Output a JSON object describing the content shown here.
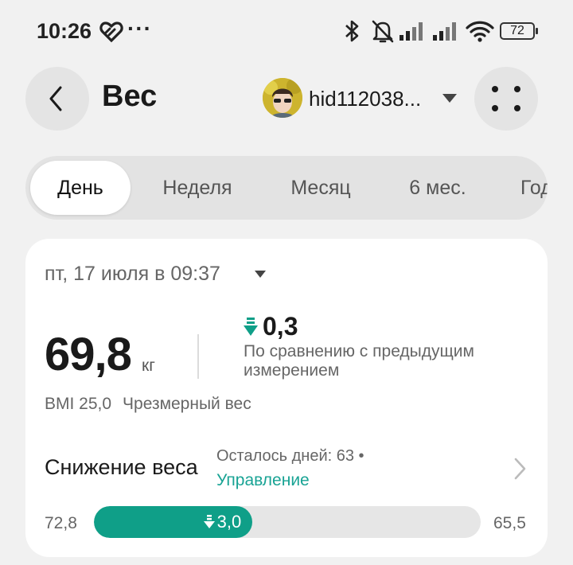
{
  "status_bar": {
    "time": "10:26",
    "dots": "···",
    "battery": "72",
    "icons": [
      "heart-icon",
      "bluetooth-icon",
      "mute-icon",
      "signal-icon",
      "signal-icon",
      "wifi-icon",
      "battery-icon"
    ]
  },
  "header": {
    "title": "Вес",
    "account_name": "hid112038...",
    "back_icon": "chevron-left-icon",
    "more_icon": "grid-dots-icon"
  },
  "tabs": [
    {
      "label": "День",
      "active": true
    },
    {
      "label": "Неделя",
      "active": false
    },
    {
      "label": "Месяц",
      "active": false
    },
    {
      "label": "6 мес.",
      "active": false
    },
    {
      "label": "Год",
      "active": false
    }
  ],
  "summary": {
    "date": "пт, 17 июля в 09:37",
    "weight": "69,8",
    "unit": "кг",
    "delta": "0,3",
    "delta_direction": "down",
    "delta_caption": "По сравнению с предыдущим измерением",
    "bmi": "BMI 25,0",
    "bmi_status": "Чрезмерный вес"
  },
  "goal": {
    "title": "Снижение веса",
    "days_left": "Осталось дней: 63 •",
    "manage_label": "Управление",
    "start": "72,8",
    "end": "65,5",
    "progress_label": "3,0",
    "progress_fraction": 0.41
  },
  "colors": {
    "accent": "#0f9f88",
    "link": "#18a394",
    "background": "#f1f1f1",
    "card": "#ffffff"
  }
}
